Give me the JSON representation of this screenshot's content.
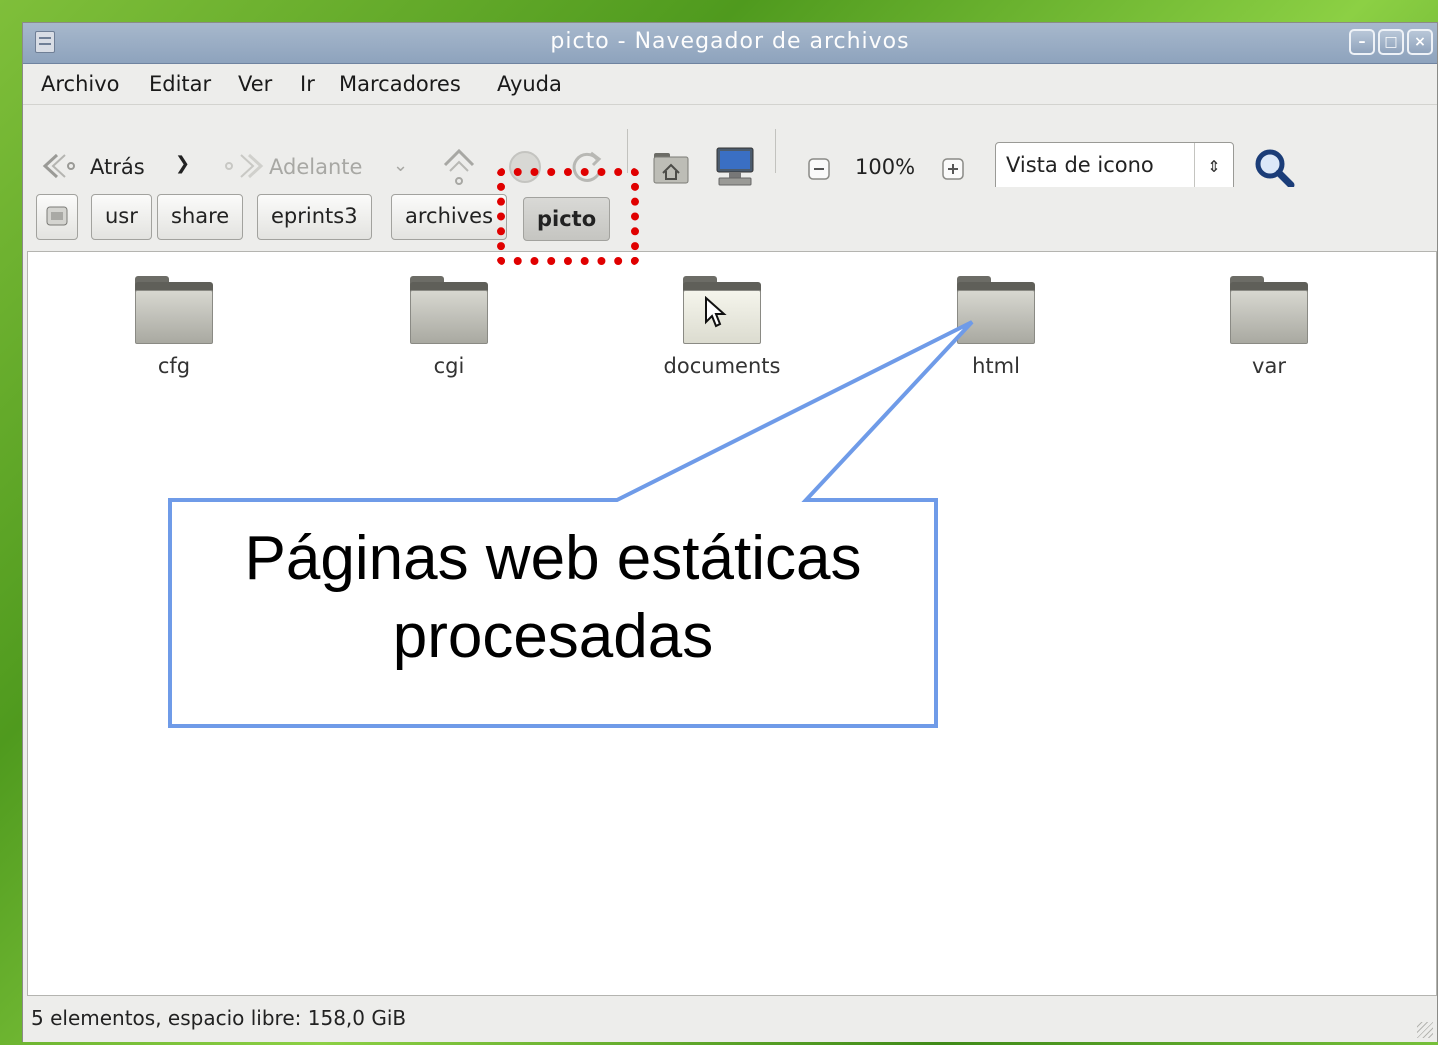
{
  "window": {
    "title": "picto - Navegador de archivos"
  },
  "menubar": {
    "items": [
      "Archivo",
      "Editar",
      "Ver",
      "Ir",
      "Marcadores",
      "Ayuda"
    ]
  },
  "toolbar": {
    "back_label": "Atrás",
    "forward_label": "Adelante",
    "zoom_level": "100%",
    "view_mode": "Vista de icono"
  },
  "pathbar": {
    "crumbs": [
      "usr",
      "share",
      "eprints3",
      "archives",
      "picto"
    ],
    "active": "picto"
  },
  "files": [
    {
      "name": "cfg"
    },
    {
      "name": "cgi"
    },
    {
      "name": "documents"
    },
    {
      "name": "html"
    },
    {
      "name": "var"
    }
  ],
  "status": {
    "text": "5 elementos, espacio libre: 158,0 GiB"
  },
  "annotation": {
    "line1": "Páginas web estáticas",
    "line2": "procesadas",
    "highlight_color": "#e00000",
    "callout_color": "#6f9be8"
  }
}
